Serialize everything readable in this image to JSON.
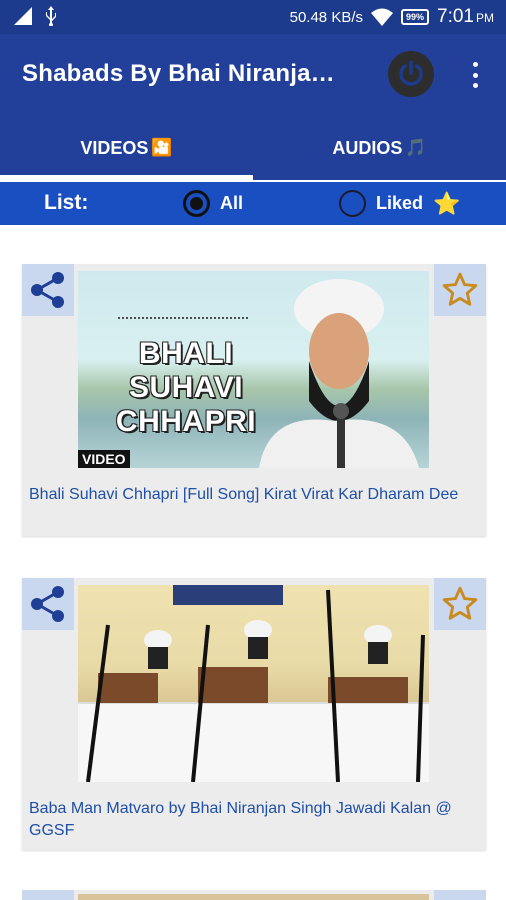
{
  "status": {
    "network_speed": "50.48 KB/s",
    "battery": "99%",
    "time": "7:01",
    "ampm": "PM"
  },
  "app": {
    "title": "Shabads By Bhai Niranja…",
    "power_icon": "power-icon",
    "menu_icon": "more-vert-icon"
  },
  "tabs": [
    {
      "label": "VIDEOS",
      "emoji": "🎦",
      "active": true
    },
    {
      "label": "AUDIOS",
      "emoji": "🎵",
      "active": false
    }
  ],
  "filter": {
    "label": "List:",
    "options": [
      {
        "label": "All",
        "selected": true
      },
      {
        "label": "Liked",
        "selected": false,
        "emoji": "⭐"
      }
    ]
  },
  "videos": [
    {
      "thumb_text": "BHALI SUHAVI CHHAPRI",
      "thumb_tag": "VIDEO",
      "caption": "Bhali Suhavi Chhapri [Full Song] Kirat Virat Kar Dharam Dee"
    },
    {
      "caption": "Baba Man Matvaro by Bhai Niranjan Singh Jawadi Kalan @ GGSF"
    }
  ],
  "colors": {
    "status_bar": "#1c3b8c",
    "app_bar": "#22409a",
    "list_bar": "#1a4fc2",
    "share_icon": "#1e3f95",
    "star_outline": "#c98a1e",
    "caption": "#1f4fa6"
  }
}
